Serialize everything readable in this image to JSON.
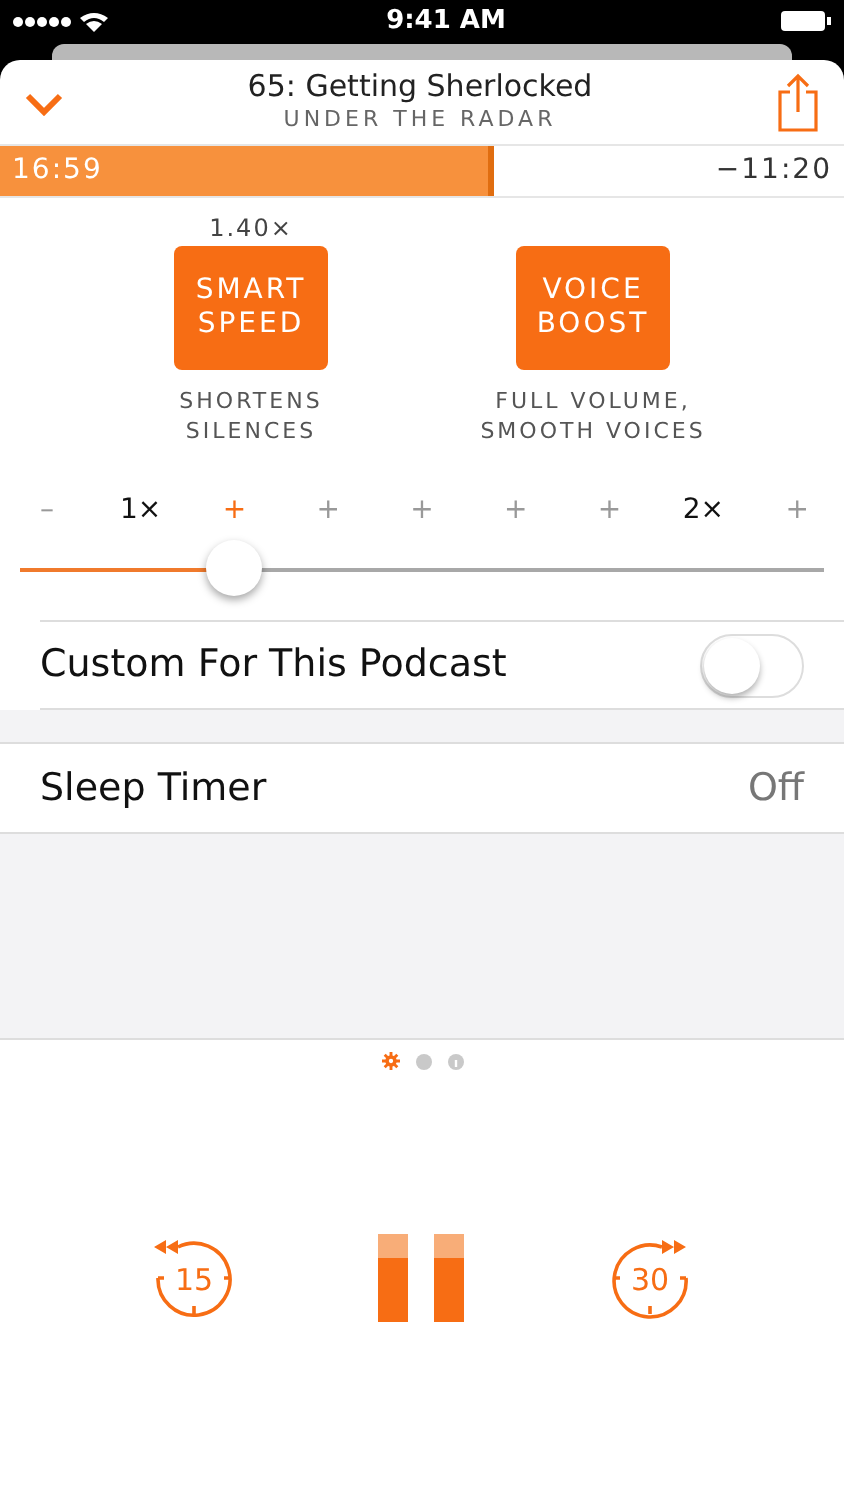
{
  "status_bar": {
    "time": "9:41 AM"
  },
  "header": {
    "title": "65: Getting Sherlocked",
    "subtitle": "UNDER THE RADAR"
  },
  "progress": {
    "elapsed": "16:59",
    "remaining": "−11:20",
    "level": 0.585
  },
  "effects": [
    {
      "reading": "1.40×",
      "label": "SMART SPEED",
      "caption": "SHORTENS SILENCES"
    },
    {
      "label": "VOICE BOOST",
      "caption": "FULL VOLUME, SMOOTH VOICES"
    }
  ],
  "speed_ticks": [
    {
      "label": "–",
      "selected": false
    },
    {
      "label": "1×",
      "selected": false
    },
    {
      "label": "+",
      "selected": true
    },
    {
      "label": "+",
      "selected": false
    },
    {
      "label": "+",
      "selected": false
    },
    {
      "label": "+",
      "selected": false
    },
    {
      "label": "+",
      "selected": false
    },
    {
      "label": "2×",
      "selected": false
    },
    {
      "label": "+",
      "selected": false
    }
  ],
  "speed_slider": {
    "level": 0.266
  },
  "custom_for_podcast": {
    "label": "Custom For This Podcast",
    "on": false
  },
  "sleep_timer": {
    "label": "Sleep Timer",
    "value": "Off"
  },
  "pages": [
    {
      "kind": "gear",
      "selected": true
    },
    {
      "kind": "dot",
      "selected": false
    },
    {
      "kind": "info",
      "selected": false
    }
  ],
  "controls": {
    "skip_back": "15",
    "skip_forward": "30"
  }
}
